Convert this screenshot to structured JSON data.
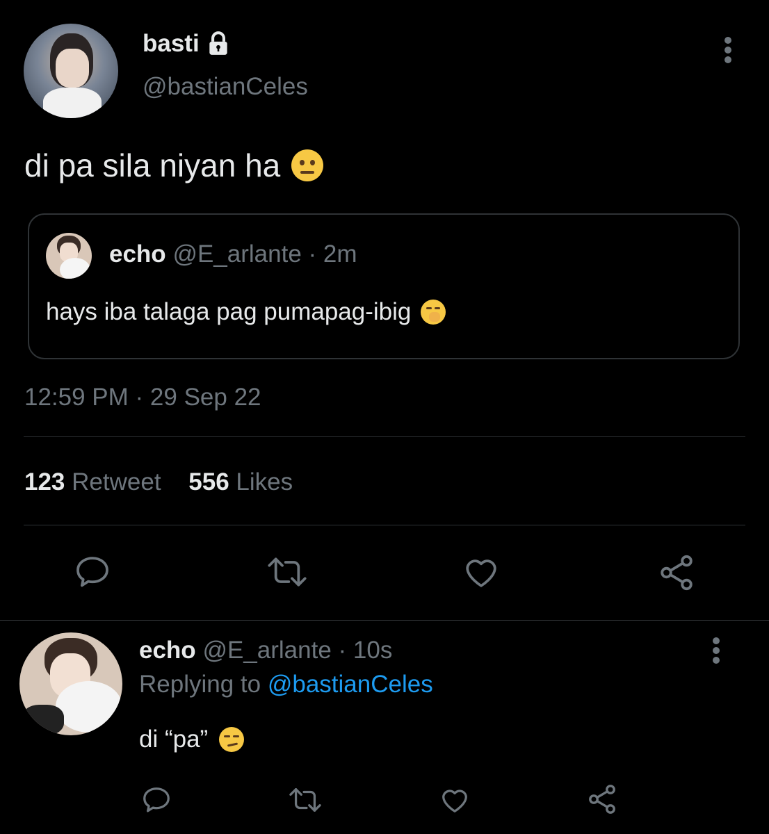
{
  "tweet": {
    "display_name": "basti",
    "handle": "@bastianCeles",
    "text": "di pa sila niyan ha",
    "quote": {
      "display_name": "echo",
      "handle": "@E_arlante",
      "time": "· 2m",
      "text": "hays iba talaga pag pumapag-ibig"
    },
    "timestamp": "12:59 PM · 29 Sep 22",
    "stats": {
      "retweet_count": "123",
      "retweet_label": "Retweet",
      "likes_count": "556",
      "likes_label": "Likes"
    }
  },
  "reply": {
    "display_name": "echo",
    "handle": "@E_arlante",
    "time": "· 10s",
    "replying_prefix": "Replying to",
    "replying_handle": "@bastianCeles",
    "text": "di “pa”"
  },
  "colors": {
    "background": "#000000",
    "text": "#e7e9ea",
    "muted": "#6e767d",
    "link": "#1d9bf0",
    "divider": "#2f3336"
  },
  "icons": [
    "lock-icon",
    "more-vertical-icon",
    "reply-icon",
    "retweet-icon",
    "like-icon",
    "share-icon"
  ]
}
